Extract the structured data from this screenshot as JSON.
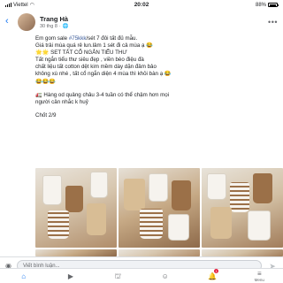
{
  "status_bar": {
    "carrier": "Viettel",
    "time": "20:02",
    "battery": "88%",
    "battery_level": 0.88
  },
  "post_header": {
    "name": "Trang Hà",
    "date": "30 thg 8",
    "visibility_icon": "globe-icon",
    "back_icon": "chevron-left-icon",
    "more_icon": "more-icon"
  },
  "post_body": {
    "line1_prefix": "Em gom sale ",
    "line1_hashtag": "#75kkk",
    "line1_suffix": "/sét 7 đôi tất đủ mẫu.",
    "line2": "Giá trải mùa quá rẻ lun.lâm 1 sét đi cả mùa ạ 😂",
    "line3": "🌟🌟 SET TẤT CỔ NGẮN TIỂU THƯ",
    "line4": "Tất ngắn tiểu thư siêu đẹp , viền bèo điệu đà",
    "line5": " chất liệu tất cotton dệt kim mềm dày dặn đảm bảo",
    "line6": "không xù nhé , tất cổ ngắn diện 4 mùa thì khỏi bàn ạ 😂",
    "line7": "😂😂😂",
    "line8": "🚛 Hàng od quảng châu 3-4 tuần có thể chậm hơn mọi",
    "line9": "người cân nhắc k huỷ",
    "line10": "Chốt 2/9"
  },
  "comment_bar": {
    "placeholder": "Viết bình luận..."
  },
  "tabs": [
    {
      "icon": "home-icon",
      "glyph": "⌂",
      "label": ""
    },
    {
      "icon": "video-icon",
      "glyph": "▶",
      "label": ""
    },
    {
      "icon": "store-icon",
      "glyph": "⛫",
      "label": ""
    },
    {
      "icon": "profile-icon",
      "glyph": "☺",
      "label": ""
    },
    {
      "icon": "bell-icon",
      "glyph": "🔔",
      "label": "",
      "badge": "1"
    },
    {
      "icon": "menu-icon",
      "glyph": "≡",
      "label": "Menu"
    }
  ]
}
